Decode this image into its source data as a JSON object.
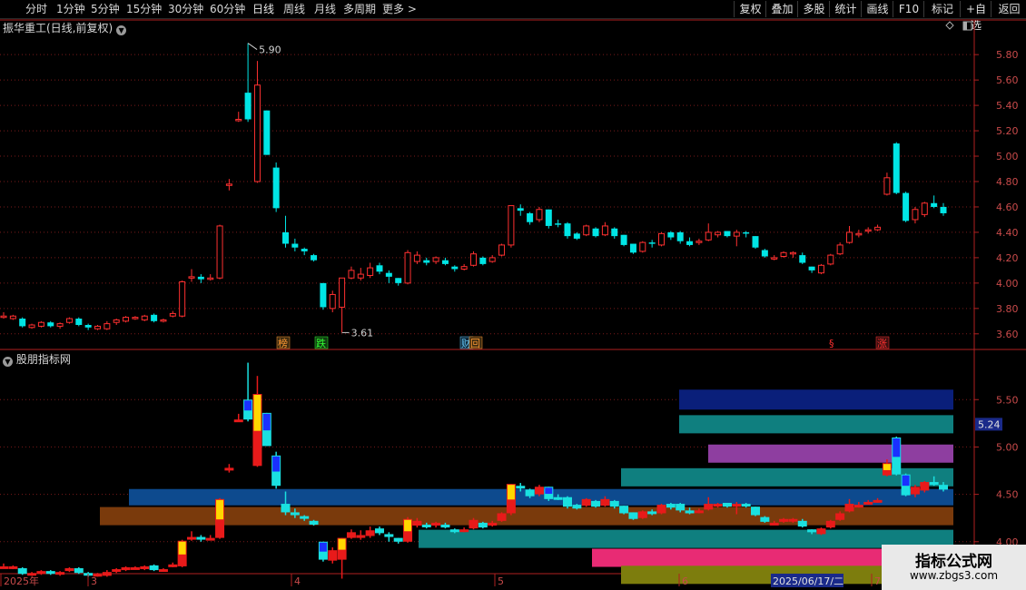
{
  "toolbar": {
    "left_items": [
      "分时",
      "1分钟",
      "5分钟",
      "15分钟",
      "30分钟",
      "60分钟",
      "日线",
      "周线",
      "月线",
      "多周期",
      "更多 >"
    ],
    "right_items": [
      "复权",
      "叠加",
      "多股",
      "统计",
      "画线",
      "F10",
      "+自选",
      "返回"
    ],
    "right_flag_label": "标记"
  },
  "main_panel": {
    "title": "振华重工(日线,前复权)",
    "y_ticks": [
      "5.80",
      "5.60",
      "5.40",
      "5.20",
      "5.00",
      "4.80",
      "4.60",
      "4.40",
      "4.20",
      "4.00",
      "3.80",
      "3.60"
    ],
    "high_label": "5.90",
    "low_label": "3.61",
    "markers": [
      {
        "text": "榜",
        "color": "#ff9933",
        "bg": "#3a2a10"
      },
      {
        "text": "跌",
        "color": "#33ff33",
        "bg": "#103a10"
      },
      {
        "text": "财",
        "color": "#66ccff",
        "bg": "#102a3a"
      },
      {
        "text": "回",
        "color": "#ff9933",
        "bg": "#3a2a10"
      },
      {
        "text": "§",
        "color": "#ff3030",
        "bg": ""
      },
      {
        "text": "涨",
        "color": "#ff3030",
        "bg": "#3a1010"
      }
    ]
  },
  "sub_panel": {
    "title": "股朋指标网",
    "y_ticks": [
      "5.50",
      "5.00",
      "4.50",
      "4.00"
    ],
    "current_value": "5.24"
  },
  "x_axis": {
    "labels": [
      "2025年",
      "3",
      "4",
      "5",
      "6",
      "7"
    ],
    "cursor_date": "2025/06/17/二"
  },
  "watermark": {
    "line1": "指标公式网",
    "line2": "www.zbgs3.com"
  },
  "chart_data": {
    "type": "candlestick",
    "title": "振华重工(日线,前复权)",
    "ylim": [
      3.55,
      5.98
    ],
    "high": 5.9,
    "low": 3.61,
    "candles": [
      [
        3.74,
        3.74,
        3.77,
        3.72
      ],
      [
        3.72,
        3.74,
        3.75,
        3.71
      ],
      [
        3.72,
        3.66,
        3.73,
        3.65
      ],
      [
        3.65,
        3.67,
        3.68,
        3.64
      ],
      [
        3.66,
        3.69,
        3.7,
        3.65
      ],
      [
        3.69,
        3.66,
        3.7,
        3.65
      ],
      [
        3.66,
        3.68,
        3.69,
        3.64
      ],
      [
        3.69,
        3.72,
        3.73,
        3.68
      ],
      [
        3.72,
        3.67,
        3.73,
        3.66
      ],
      [
        3.67,
        3.65,
        3.68,
        3.63
      ],
      [
        3.64,
        3.66,
        3.67,
        3.63
      ],
      [
        3.64,
        3.68,
        3.7,
        3.63
      ],
      [
        3.69,
        3.71,
        3.72,
        3.67
      ],
      [
        3.7,
        3.73,
        3.74,
        3.69
      ],
      [
        3.72,
        3.73,
        3.74,
        3.71
      ],
      [
        3.71,
        3.74,
        3.75,
        3.7
      ],
      [
        3.75,
        3.7,
        3.76,
        3.69
      ],
      [
        3.7,
        3.71,
        3.72,
        3.69
      ],
      [
        3.74,
        3.76,
        3.78,
        3.73
      ],
      [
        3.74,
        4.01,
        4.02,
        3.73
      ],
      [
        4.04,
        4.05,
        4.11,
        4.01
      ],
      [
        4.05,
        4.03,
        4.07,
        4.0
      ],
      [
        4.03,
        4.04,
        4.07,
        4.02
      ],
      [
        4.04,
        4.45,
        4.46,
        4.03
      ],
      [
        4.78,
        4.78,
        4.82,
        4.73
      ],
      [
        5.28,
        5.29,
        5.35,
        5.27
      ],
      [
        5.5,
        5.29,
        5.89,
        5.27
      ],
      [
        4.8,
        5.56,
        5.75,
        4.79
      ],
      [
        5.36,
        5.01,
        5.36,
        5.01
      ],
      [
        4.91,
        4.59,
        4.95,
        4.56
      ],
      [
        4.4,
        4.31,
        4.53,
        4.28
      ],
      [
        4.31,
        4.28,
        4.35,
        4.25
      ],
      [
        4.27,
        4.25,
        4.28,
        4.22
      ],
      [
        4.22,
        4.18,
        4.23,
        4.17
      ],
      [
        4.0,
        3.81,
        4.0,
        3.79
      ],
      [
        3.8,
        3.91,
        3.94,
        3.77
      ],
      [
        3.81,
        4.04,
        4.04,
        3.61
      ],
      [
        4.04,
        4.1,
        4.13,
        4.03
      ],
      [
        4.04,
        4.07,
        4.12,
        4.02
      ],
      [
        4.06,
        4.12,
        4.16,
        4.04
      ],
      [
        4.14,
        4.09,
        4.16,
        4.07
      ],
      [
        4.08,
        4.05,
        4.1,
        4.0
      ],
      [
        4.04,
        4.0,
        4.04,
        3.98
      ],
      [
        4.0,
        4.24,
        4.26,
        3.99
      ],
      [
        4.17,
        4.22,
        4.25,
        4.15
      ],
      [
        4.18,
        4.16,
        4.2,
        4.14
      ],
      [
        4.17,
        4.2,
        4.21,
        4.15
      ],
      [
        4.18,
        4.15,
        4.2,
        4.14
      ],
      [
        4.13,
        4.11,
        4.14,
        4.09
      ],
      [
        4.11,
        4.13,
        4.15,
        4.1
      ],
      [
        4.14,
        4.23,
        4.25,
        4.13
      ],
      [
        4.2,
        4.15,
        4.21,
        4.14
      ],
      [
        4.17,
        4.2,
        4.22,
        4.16
      ],
      [
        4.22,
        4.3,
        4.31,
        4.21
      ],
      [
        4.3,
        4.61,
        4.61,
        4.28
      ],
      [
        4.59,
        4.57,
        4.62,
        4.53
      ],
      [
        4.55,
        4.48,
        4.56,
        4.46
      ],
      [
        4.5,
        4.58,
        4.6,
        4.48
      ],
      [
        4.58,
        4.45,
        4.58,
        4.43
      ],
      [
        4.47,
        4.46,
        4.5,
        4.44
      ],
      [
        4.47,
        4.37,
        4.48,
        4.35
      ],
      [
        4.39,
        4.35,
        4.4,
        4.34
      ],
      [
        4.38,
        4.45,
        4.46,
        4.37
      ],
      [
        4.43,
        4.37,
        4.44,
        4.36
      ],
      [
        4.38,
        4.45,
        4.48,
        4.37
      ],
      [
        4.43,
        4.37,
        4.44,
        4.35
      ],
      [
        4.38,
        4.3,
        4.38,
        4.29
      ],
      [
        4.31,
        4.24,
        4.31,
        4.23
      ],
      [
        4.25,
        4.32,
        4.33,
        4.24
      ],
      [
        4.32,
        4.31,
        4.34,
        4.28
      ],
      [
        4.3,
        4.39,
        4.4,
        4.29
      ],
      [
        4.4,
        4.36,
        4.41,
        4.34
      ],
      [
        4.4,
        4.33,
        4.41,
        4.31
      ],
      [
        4.33,
        4.3,
        4.36,
        4.29
      ],
      [
        4.32,
        4.33,
        4.35,
        4.3
      ],
      [
        4.34,
        4.4,
        4.47,
        4.33
      ],
      [
        4.38,
        4.4,
        4.41,
        4.36
      ],
      [
        4.41,
        4.37,
        4.41,
        4.36
      ],
      [
        4.37,
        4.4,
        4.42,
        4.29
      ],
      [
        4.4,
        4.39,
        4.41,
        4.36
      ],
      [
        4.37,
        4.28,
        4.37,
        4.27
      ],
      [
        4.26,
        4.21,
        4.27,
        4.2
      ],
      [
        4.19,
        4.2,
        4.22,
        4.18
      ],
      [
        4.21,
        4.24,
        4.25,
        4.2
      ],
      [
        4.23,
        4.24,
        4.25,
        4.2
      ],
      [
        4.22,
        4.16,
        4.24,
        4.15
      ],
      [
        4.13,
        4.1,
        4.13,
        4.08
      ],
      [
        4.08,
        4.14,
        4.15,
        4.07
      ],
      [
        4.15,
        4.22,
        4.23,
        4.14
      ],
      [
        4.23,
        4.3,
        4.32,
        4.22
      ],
      [
        4.32,
        4.4,
        4.45,
        4.31
      ],
      [
        4.39,
        4.39,
        4.42,
        4.36
      ],
      [
        4.41,
        4.42,
        4.44,
        4.39
      ],
      [
        4.42,
        4.44,
        4.46,
        4.41
      ],
      [
        4.7,
        4.83,
        4.87,
        4.69
      ],
      [
        5.1,
        4.71,
        5.11,
        4.7
      ],
      [
        4.71,
        4.49,
        4.72,
        4.48
      ],
      [
        4.5,
        4.58,
        4.6,
        4.47
      ],
      [
        4.54,
        4.63,
        4.64,
        4.52
      ],
      [
        4.63,
        4.6,
        4.69,
        4.59
      ],
      [
        4.6,
        4.55,
        4.63,
        4.53
      ]
    ],
    "bands": [
      {
        "level": 5.5,
        "color": "#0a1f7a"
      },
      {
        "level": 5.24,
        "color": "#0f7f7f"
      },
      {
        "level": 4.93,
        "color": "#8e3ea0"
      },
      {
        "level": 4.68,
        "color": "#0f7f7f"
      },
      {
        "level": 4.47,
        "color": "#0d4a8e"
      },
      {
        "level": 4.27,
        "color": "#7a3a0c"
      },
      {
        "level": 4.03,
        "color": "#0f7f7f"
      },
      {
        "level": 3.83,
        "color": "#e82b74"
      },
      {
        "level": 3.65,
        "color": "#7d7d0d"
      }
    ],
    "colors": {
      "up": "#ff3030",
      "down": "#00e5e5",
      "grid": "#7a1a1a",
      "axis": "#b02020",
      "tick_text": "#c84a4a"
    }
  }
}
